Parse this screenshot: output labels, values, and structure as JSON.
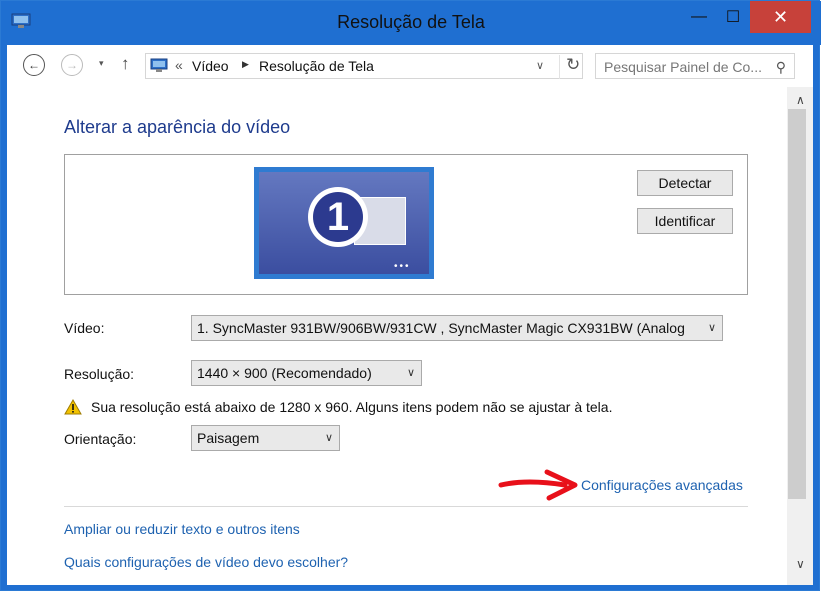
{
  "window": {
    "title": "Resolução de Tela",
    "minimize": "—",
    "maximize": "☐",
    "close": "✕"
  },
  "toolbar": {
    "back": "←",
    "forward": "→",
    "recent": "▾",
    "up": "↑",
    "breadcrumb_sep": "«",
    "breadcrumb": [
      "Vídeo",
      "Resolução de Tela"
    ],
    "crumb_arrow": "▶",
    "address_chevron": "∨",
    "refresh": "↻",
    "search_placeholder": "Pesquisar Painel de Co...",
    "search_icon": "⚲"
  },
  "main": {
    "heading": "Alterar a aparência do vídeo",
    "monitor_number": "1",
    "monitor_dots": "•••",
    "detect_label": "Detectar",
    "identify_label": "Identificar",
    "video_label": "Vídeo:",
    "video_value": "1. SyncMaster 931BW/906BW/931CW , SyncMaster Magic CX931BW (Analog",
    "resolution_label": "Resolução:",
    "resolution_value": "1440 × 900 (Recomendado)",
    "warning_text": "Sua resolução está abaixo de 1280 x 960. Alguns itens podem não se ajustar à tela.",
    "orientation_label": "Orientação:",
    "orientation_value": "Paisagem",
    "advanced_link": "Configurações avançadas",
    "link1": "Ampliar ou reduzir texto e outros itens",
    "link2": "Quais configurações de vídeo devo escolher?",
    "chevron": "∨"
  },
  "scrollbar": {
    "up": "∧",
    "down": "∨"
  },
  "colors": {
    "title_bar": "#1f6fd1",
    "close": "#c7413a",
    "link": "#1e62b0",
    "heading": "#1e3b8d",
    "arrow": "#e8101a"
  }
}
